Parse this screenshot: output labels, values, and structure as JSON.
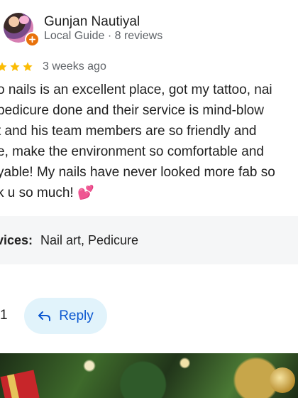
{
  "review": {
    "user": {
      "name": "Gunjan Nautiyal",
      "meta": "Local Guide · 8 reviews",
      "avatar_icon": "user-avatar-photo",
      "badge_icon": "local-guide-badge-icon",
      "badge_color": "#e8710a"
    },
    "rating": {
      "stars_visible": 3,
      "star_color": "#fbbc04",
      "time_ago": "3 weeks ago"
    },
    "body_lines": [
      "o nails is an excellent place, got my  tattoo, nai",
      "pedicure done and their service is mind-blow",
      "t and his team members are so friendly and",
      "e, make the environment so comfortable and",
      "yable! My nails have never looked more fab so",
      "k u so much! 💕"
    ],
    "services": {
      "label": "rvices:",
      "value": "Nail art, Pedicure"
    },
    "actions": {
      "like_count": "1",
      "reply_label": "Reply",
      "reply_icon": "reply-arrow-icon",
      "reply_color": "#0b57d0",
      "reply_bg": "#e1f3fb"
    },
    "photo": {
      "icon": "review-photo"
    }
  }
}
